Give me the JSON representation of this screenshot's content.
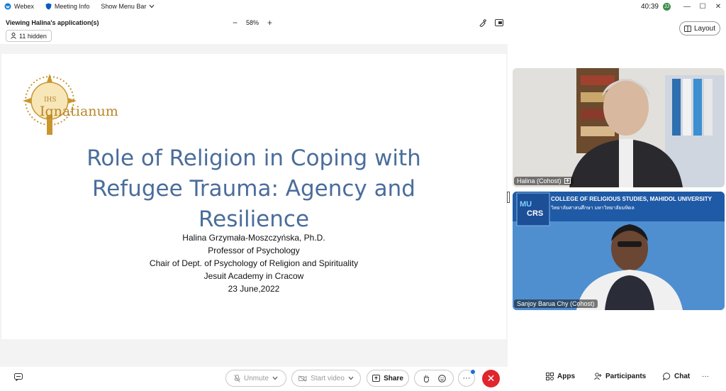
{
  "titlebar": {
    "app_name": "Webex",
    "meeting_info": "Meeting Info",
    "menu_bar": "Show Menu Bar",
    "clock": "40:39",
    "avatar_initial": "JJ"
  },
  "viewbar": {
    "viewing_text": "Viewing Halina's application(s)",
    "zoom_minus": "−",
    "zoom_level": "58%",
    "zoom_plus": "+"
  },
  "hidden_chip": {
    "label": "11 hidden"
  },
  "layout_button": {
    "label": "Layout"
  },
  "slide": {
    "logo_text_top": "IHS",
    "logo_text": "Ignatianum",
    "title_lines": [
      "Role of Religion in Coping with",
      "Refugee Trauma: Agency and",
      "Resilience"
    ],
    "body_lines": [
      "Halina Grzymała-Moszczyńska, Ph.D.",
      "Professor of Psychology",
      "Chair of Dept. of Psychology of Religion and Spirituality",
      "Jesuit Academy in Cracow",
      "23 June,2022"
    ]
  },
  "participants": [
    {
      "name": "Halina (Cohost)"
    },
    {
      "name": "Sanjoy Barua Chy (Cohost)",
      "banner_en": "COLLEGE OF RELIGIOUS STUDIES, MAHIDOL UNIVERSITY",
      "banner_th": "วิทยาลัยศาสนศึกษา มหาวิทยาลัยมหิดล",
      "logo_text_1": "MU",
      "logo_text_2": "CRS"
    }
  ],
  "controls": {
    "unmute": "Unmute",
    "start_video": "Start video",
    "share": "Share",
    "more": "···",
    "apps": "Apps",
    "participants": "Participants",
    "chat": "Chat",
    "overflow": "···"
  },
  "colors": {
    "slide_title": "#4a6d9b",
    "end_call": "#e0262c",
    "tile_bg_blue": "#4a86c8"
  }
}
